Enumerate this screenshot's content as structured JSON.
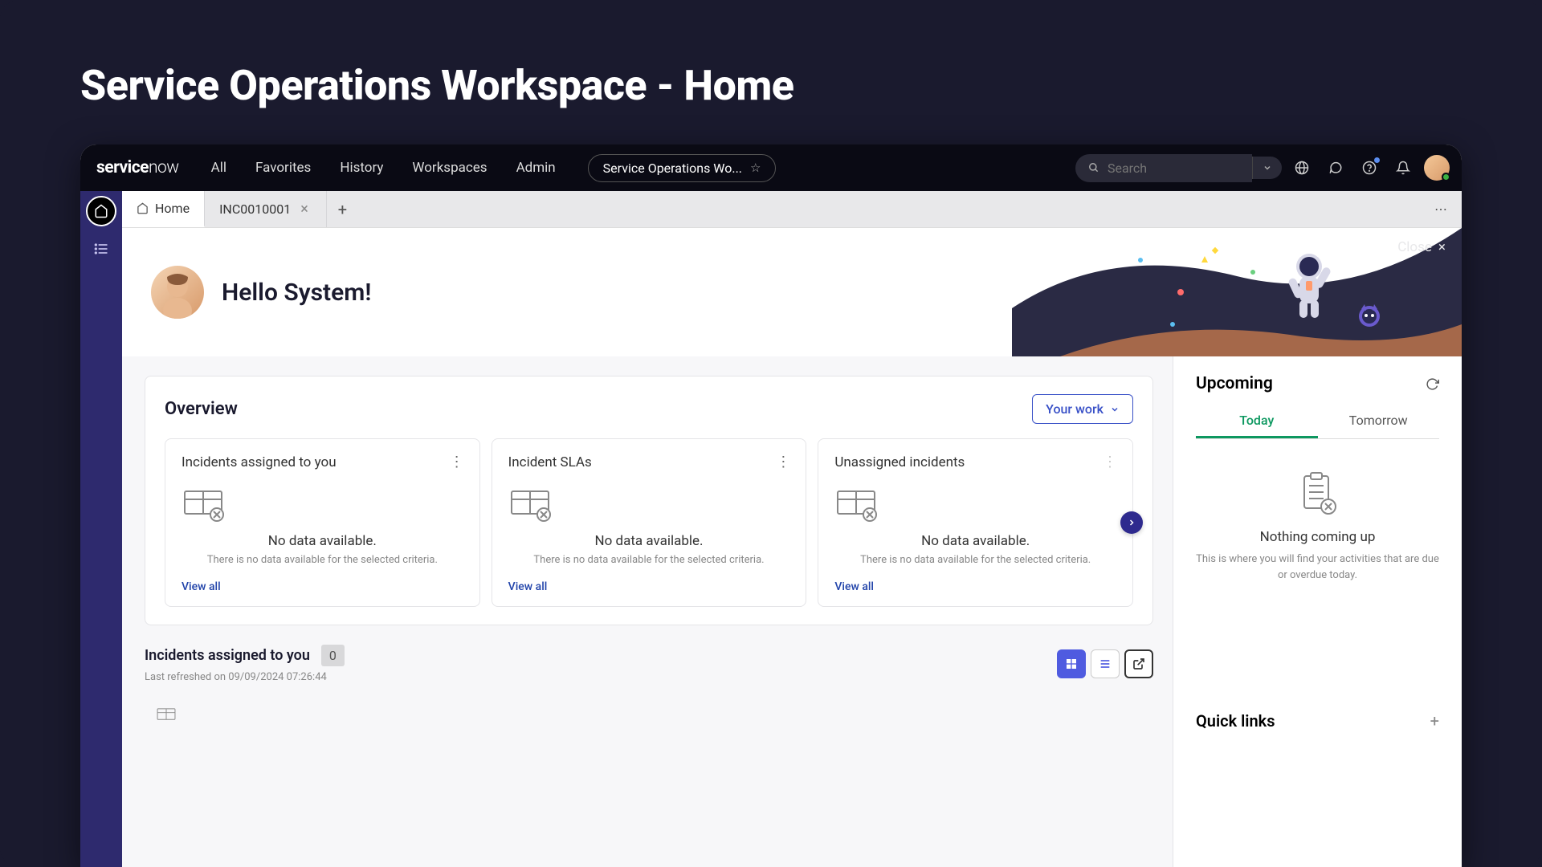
{
  "page_heading": "Service Operations Workspace - Home",
  "logo_a": "service",
  "logo_b": "now",
  "nav": {
    "all": "All",
    "favorites": "Favorites",
    "history": "History",
    "workspaces": "Workspaces",
    "admin": "Admin"
  },
  "workspace_pill": "Service Operations Wo...",
  "search_placeholder": "Search",
  "tabs": {
    "home": "Home",
    "inc": "INC0010001"
  },
  "hero": {
    "greeting": "Hello System!",
    "close": "Close"
  },
  "overview": {
    "title": "Overview",
    "filter": "Your work",
    "cards": [
      {
        "title": "Incidents assigned to you",
        "empty_title": "No data available.",
        "empty_sub": "There is no data available for the selected criteria.",
        "view_all": "View all"
      },
      {
        "title": "Incident SLAs",
        "empty_title": "No data available.",
        "empty_sub": "There is no data available for the selected criteria.",
        "view_all": "View all"
      },
      {
        "title": "Unassigned incidents",
        "empty_title": "No data available.",
        "empty_sub": "There is no data available for the selected criteria.",
        "view_all": "View all"
      }
    ]
  },
  "section2": {
    "title": "Incidents assigned to you",
    "count": "0",
    "refreshed": "Last refreshed on 09/09/2024 07:26:44"
  },
  "upcoming": {
    "title": "Upcoming",
    "today": "Today",
    "tomorrow": "Tomorrow",
    "empty_title": "Nothing coming up",
    "empty_sub": "This is where you will find your activities that are due or overdue today."
  },
  "quicklinks": {
    "title": "Quick links"
  }
}
